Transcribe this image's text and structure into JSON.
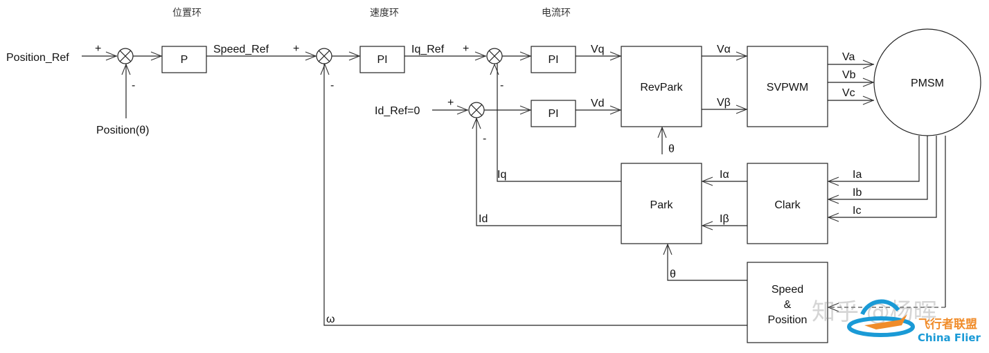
{
  "headings": {
    "position_loop": "位置环",
    "speed_loop": "速度环",
    "current_loop": "电流环"
  },
  "signals": {
    "position_ref": "Position_Ref",
    "position_theta": "Position(θ)",
    "speed_ref": "Speed_Ref",
    "iq_ref": "Iq_Ref",
    "id_ref": "Id_Ref=0",
    "vq": "Vq",
    "vd": "Vd",
    "v_alpha": "Vα",
    "v_beta": "Vβ",
    "va": "Va",
    "vb": "Vb",
    "vc": "Vc",
    "ia": "Ia",
    "ib": "Ib",
    "ic": "Ic",
    "i_alpha": "Iα",
    "i_beta": "Iβ",
    "iq": "Iq",
    "id": "Id",
    "theta_revpark": "θ",
    "theta_park": "θ",
    "omega": "ω"
  },
  "signs": {
    "plus": "+",
    "minus": "-"
  },
  "blocks": {
    "p": "P",
    "pi_speed": "PI",
    "pi_q": "PI",
    "pi_d": "PI",
    "revpark": "RevPark",
    "svpwm": "SVPWM",
    "pmsm": "PMSM",
    "park": "Park",
    "clark": "Clark",
    "speed_position": [
      "Speed",
      "&",
      "Position"
    ]
  },
  "watermark": {
    "zhihu": "知乎 @杨晖",
    "brand_cn": "飞行者联盟",
    "brand_en": "China Flier",
    "brand_color": "#1a9ad6",
    "accent_color": "#f08c2a"
  }
}
